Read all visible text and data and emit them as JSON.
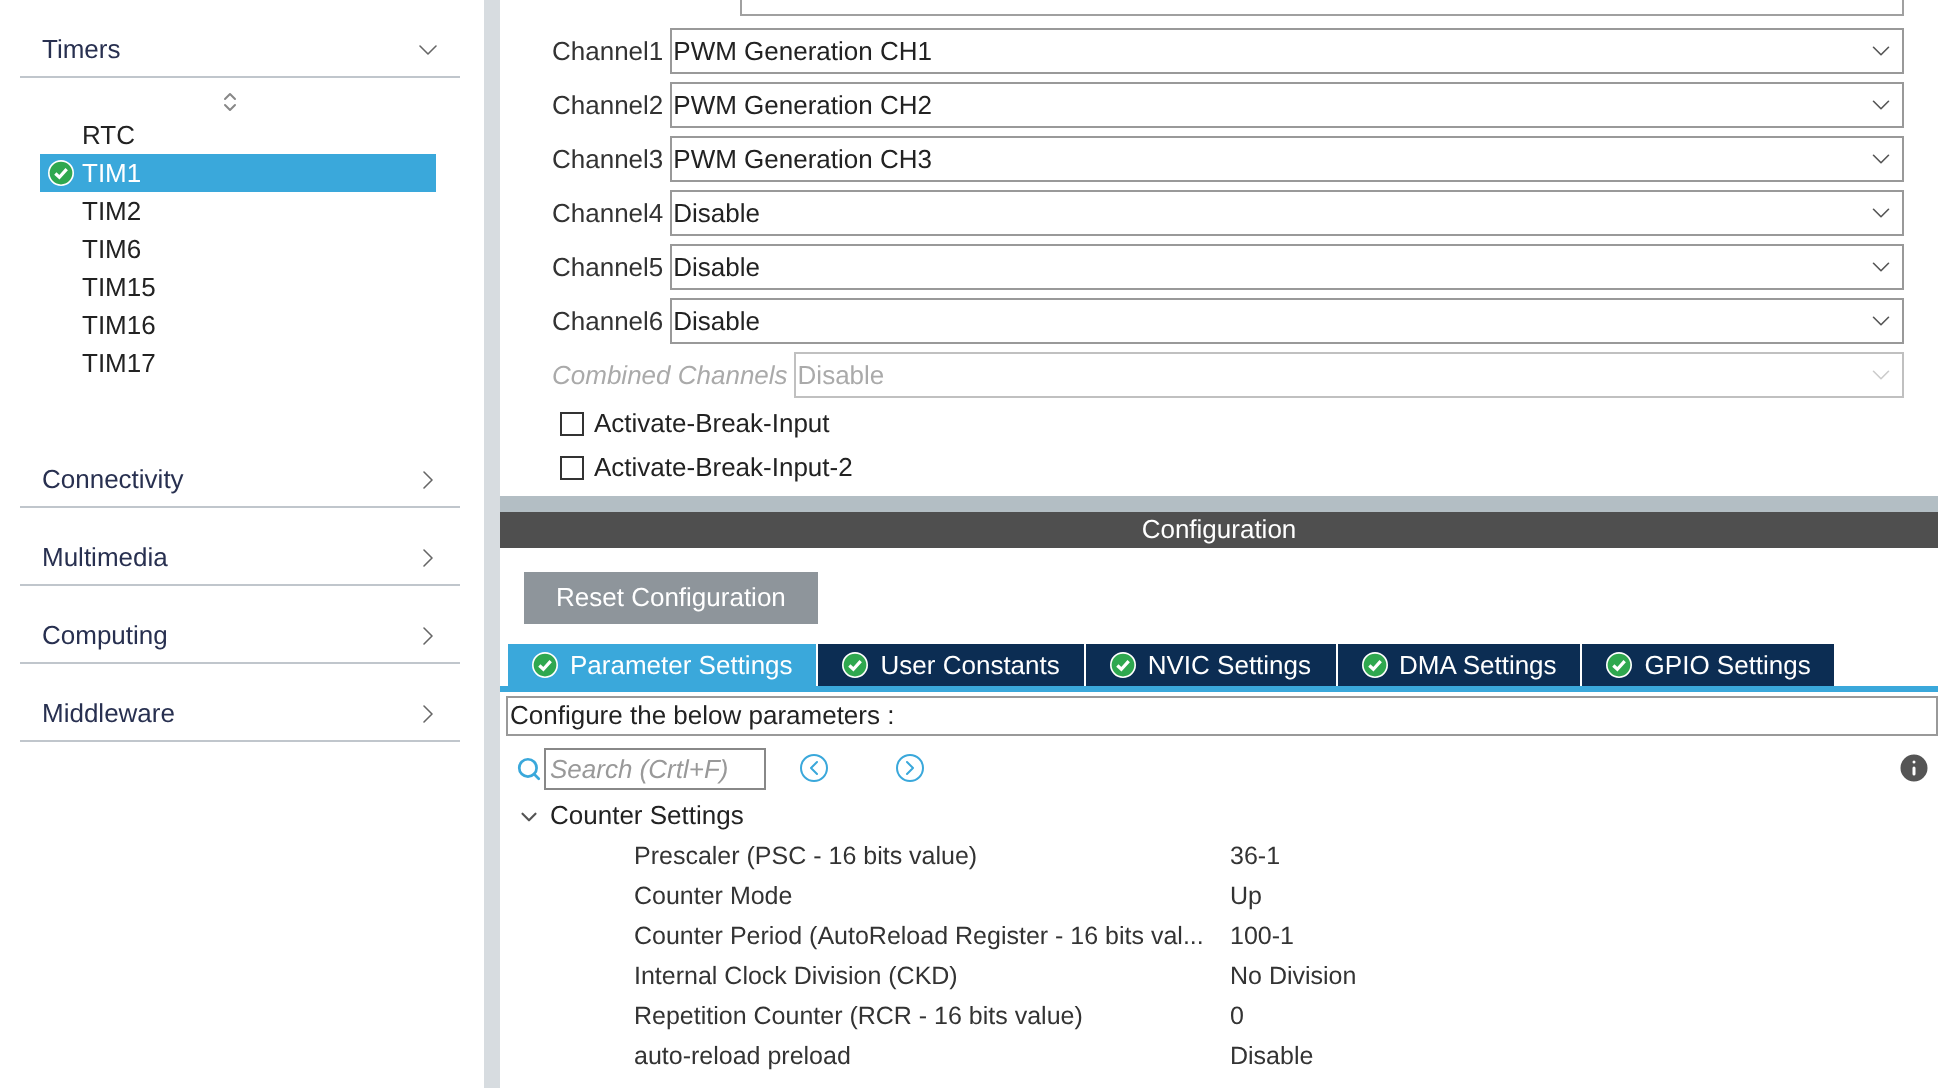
{
  "sidebar": {
    "categories": [
      {
        "label": "Timers",
        "expanded": true,
        "items": [
          {
            "label": "RTC",
            "selected": false,
            "checked": false
          },
          {
            "label": "TIM1",
            "selected": true,
            "checked": true
          },
          {
            "label": "TIM2",
            "selected": false,
            "checked": false
          },
          {
            "label": "TIM6",
            "selected": false,
            "checked": false
          },
          {
            "label": "TIM15",
            "selected": false,
            "checked": false
          },
          {
            "label": "TIM16",
            "selected": false,
            "checked": false
          },
          {
            "label": "TIM17",
            "selected": false,
            "checked": false
          }
        ]
      },
      {
        "label": "Connectivity",
        "expanded": false
      },
      {
        "label": "Multimedia",
        "expanded": false
      },
      {
        "label": "Computing",
        "expanded": false
      },
      {
        "label": "Middleware",
        "expanded": false
      }
    ]
  },
  "mode": {
    "channels": [
      {
        "label": "Channel1",
        "value": "PWM Generation CH1",
        "disabled": false
      },
      {
        "label": "Channel2",
        "value": "PWM Generation CH2",
        "disabled": false
      },
      {
        "label": "Channel3",
        "value": "PWM Generation CH3",
        "disabled": false
      },
      {
        "label": "Channel4",
        "value": "Disable",
        "disabled": false
      },
      {
        "label": "Channel5",
        "value": "Disable",
        "disabled": false
      },
      {
        "label": "Channel6",
        "value": "Disable",
        "disabled": false
      },
      {
        "label": "Combined Channels",
        "value": "Disable",
        "disabled": true
      }
    ],
    "checkboxes": [
      {
        "label": "Activate-Break-Input",
        "checked": false
      },
      {
        "label": "Activate-Break-Input-2",
        "checked": false
      }
    ]
  },
  "configuration": {
    "title": "Configuration",
    "reset_button": "Reset Configuration",
    "tabs": [
      {
        "label": "Parameter Settings",
        "selected": true
      },
      {
        "label": "User Constants",
        "selected": false
      },
      {
        "label": "NVIC Settings",
        "selected": false
      },
      {
        "label": "DMA Settings",
        "selected": false
      },
      {
        "label": "GPIO Settings",
        "selected": false
      }
    ],
    "description": "Configure the below parameters :",
    "search": {
      "placeholder": "Search (Crtl+F)"
    },
    "groups": [
      {
        "label": "Counter Settings",
        "expanded": true,
        "params": [
          {
            "name": "Prescaler (PSC - 16 bits value)",
            "value": "36-1"
          },
          {
            "name": "Counter Mode",
            "value": "Up"
          },
          {
            "name": "Counter Period (AutoReload Register - 16 bits val...",
            "value": "100-1"
          },
          {
            "name": "Internal Clock Division (CKD)",
            "value": "No Division"
          },
          {
            "name": "Repetition Counter (RCR - 16 bits value)",
            "value": "0"
          },
          {
            "name": "auto-reload preload",
            "value": "Disable"
          }
        ]
      }
    ]
  }
}
